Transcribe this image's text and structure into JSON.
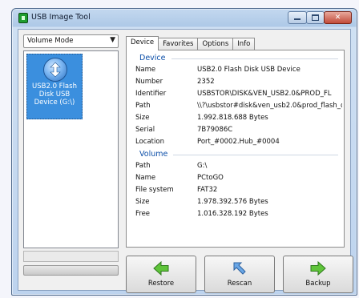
{
  "window": {
    "title": "USB Image Tool"
  },
  "left": {
    "mode_select": "Volume Mode",
    "device_item": "USB2.0 Flash Disk USB Device (G:\\)"
  },
  "tabs": [
    "Device",
    "Favorites",
    "Options",
    "Info"
  ],
  "device_group": {
    "title": "Device",
    "rows": [
      {
        "label": "Name",
        "value": "USB2.0 Flash Disk USB Device"
      },
      {
        "label": "Number",
        "value": "2352"
      },
      {
        "label": "Identifier",
        "value": "USBSTOR\\DISK&VEN_USB2.0&PROD_FL"
      },
      {
        "label": "Path",
        "value": "\\\\?\\usbstor#disk&ven_usb2.0&prod_flash_d"
      },
      {
        "label": "Size",
        "value": "1.992.818.688 Bytes"
      },
      {
        "label": "Serial",
        "value": "7B79086C"
      },
      {
        "label": "Location",
        "value": "Port_#0002.Hub_#0004"
      }
    ]
  },
  "volume_group": {
    "title": "Volume",
    "rows": [
      {
        "label": "Path",
        "value": "G:\\"
      },
      {
        "label": "Name",
        "value": "PCtoGO"
      },
      {
        "label": "File system",
        "value": "FAT32"
      },
      {
        "label": "Size",
        "value": "1.978.392.576 Bytes"
      },
      {
        "label": "Free",
        "value": "1.016.328.192 Bytes"
      }
    ]
  },
  "buttons": {
    "restore": "Restore",
    "rescan": "Rescan",
    "backup": "Backup"
  },
  "icons": {
    "app": "usb-image-tool-icon",
    "device": "usb-drive-icon",
    "restore": "green-arrow-left-icon",
    "rescan": "blue-arrow-icon",
    "backup": "green-arrow-right-icon"
  },
  "colors": {
    "selection": "#3b8fde",
    "group_title": "#0b4ea8"
  }
}
